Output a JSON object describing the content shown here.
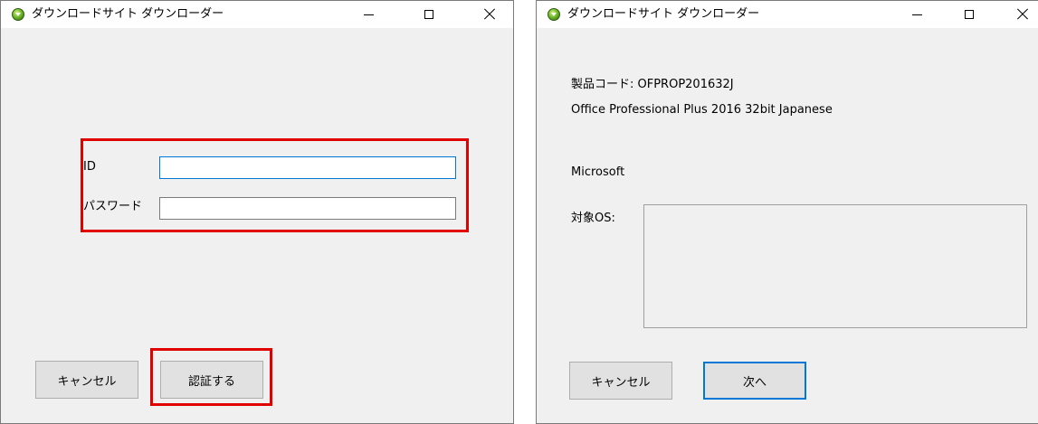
{
  "login_window": {
    "title": "ダウンロードサイト ダウンローダー",
    "id_label": "ID",
    "id_value": "",
    "password_label": "パスワード",
    "password_value": "",
    "cancel_label": "キャンセル",
    "authenticate_label": "認証する"
  },
  "product_window": {
    "title": "ダウンロードサイト ダウンローダー",
    "product_code": "製品コード: OFPROP201632J",
    "product_name": "Office Professional Plus 2016 32bit Japanese",
    "vendor": "Microsoft",
    "target_os_label": "対象OS:",
    "target_os_value": "",
    "cancel_label": "キャンセル",
    "next_label": "次へ"
  },
  "annotations": {
    "highlight_color": "#e00000"
  }
}
